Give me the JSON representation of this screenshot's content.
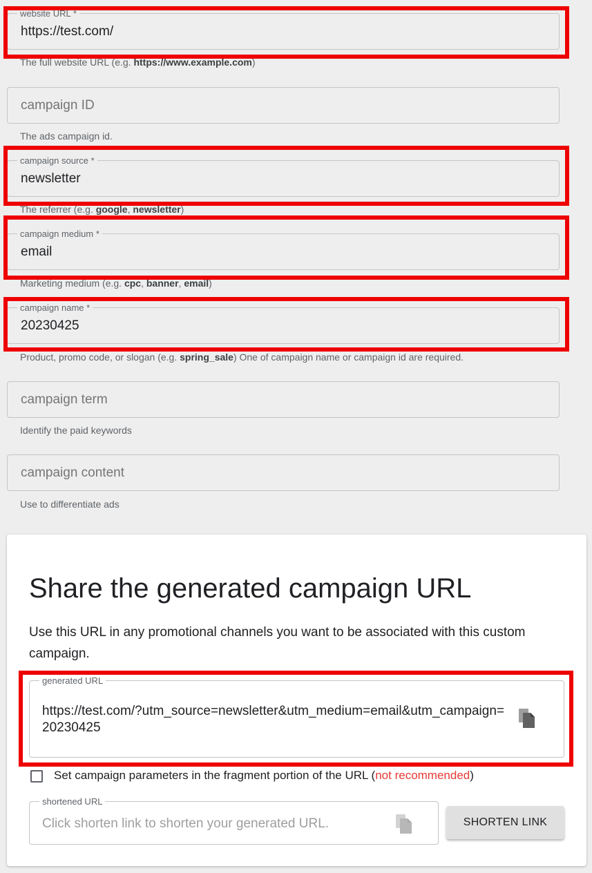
{
  "form": {
    "website_url": {
      "label": "website URL *",
      "value": "https://test.com/",
      "helper_prefix": "The full website URL (e.g. ",
      "helper_bold": "https://www.example.com",
      "helper_suffix": ")"
    },
    "campaign_id": {
      "placeholder": "campaign ID",
      "helper": "The ads campaign id."
    },
    "campaign_source": {
      "label": "campaign source *",
      "value": "newsletter",
      "helper_prefix": "The referrer (e.g. ",
      "helper_bold_1": "google",
      "helper_sep": ", ",
      "helper_bold_2": "newsletter",
      "helper_suffix": ")"
    },
    "campaign_medium": {
      "label": "campaign medium *",
      "value": "email",
      "helper_prefix": "Marketing medium (e.g. ",
      "helper_bold_1": "cpc",
      "helper_sep_1": ", ",
      "helper_bold_2": "banner",
      "helper_sep_2": ", ",
      "helper_bold_3": "email",
      "helper_suffix": ")"
    },
    "campaign_name": {
      "label": "campaign name *",
      "value": "20230425",
      "helper_prefix": "Product, promo code, or slogan (e.g. ",
      "helper_bold": "spring_sale",
      "helper_suffix": ") One of campaign name or campaign id are required."
    },
    "campaign_term": {
      "placeholder": "campaign term",
      "helper": "Identify the paid keywords"
    },
    "campaign_content": {
      "placeholder": "campaign content",
      "helper": "Use to differentiate ads"
    }
  },
  "share": {
    "title": "Share the generated campaign URL",
    "description": "Use this URL in any promotional channels you want to be associated with this custom campaign.",
    "generated_url_label": "generated URL",
    "generated_url": "https://test.com/?utm_source=newsletter&utm_medium=email&utm_campaign=20230425",
    "fragment_checkbox_text": "Set campaign parameters in the fragment portion of the URL (",
    "fragment_checkbox_warning": "not recommended",
    "fragment_checkbox_close": ")",
    "fragment_checked": false,
    "shortened_url_label": "shortened URL",
    "shortened_url_placeholder": "Click shorten link to shorten your generated URL.",
    "shorten_button": "SHORTEN LINK"
  },
  "icons": {
    "copy_generated": "copy-icon",
    "copy_shortened": "copy-icon"
  },
  "colors": {
    "highlight": "#ee0000",
    "warning_text": "#e53935",
    "background": "#eeeeee",
    "card": "#ffffff"
  }
}
